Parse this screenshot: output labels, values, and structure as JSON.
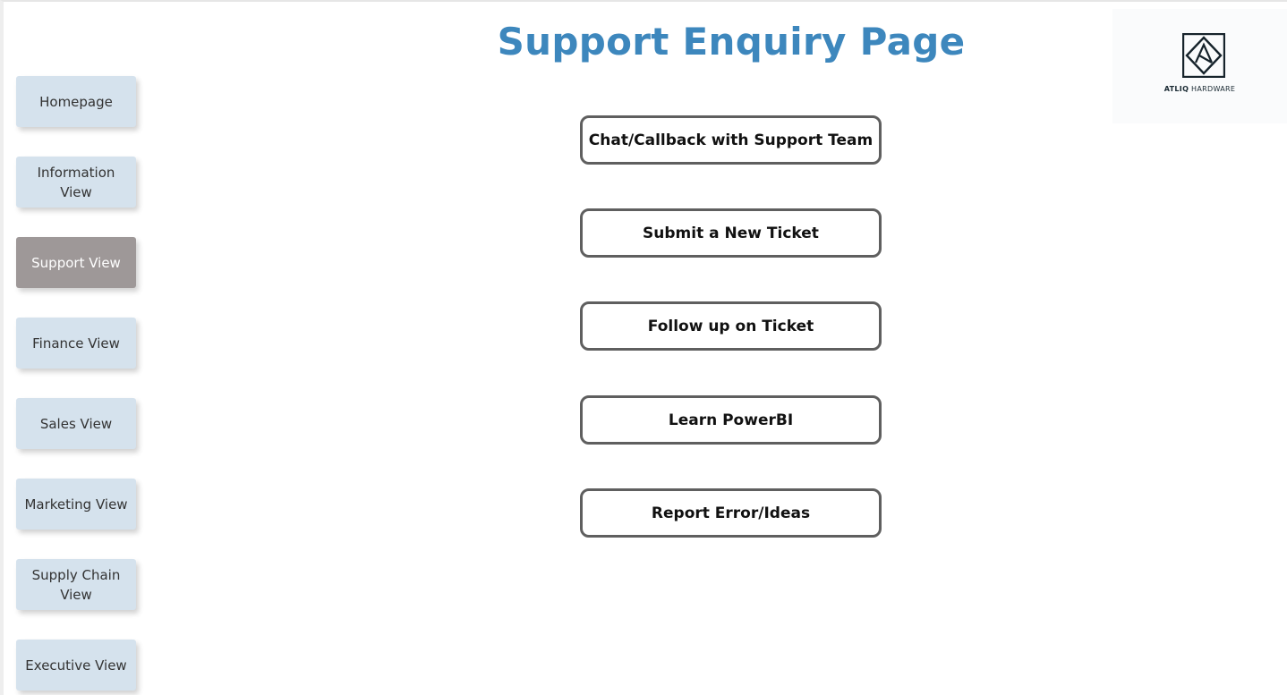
{
  "page": {
    "title": "Support Enquiry Page"
  },
  "logo": {
    "brand_bold": "ATLIQ",
    "brand_rest": "HARDWARE"
  },
  "sidebar": {
    "items": [
      {
        "label": "Homepage",
        "active": false
      },
      {
        "label": "Information View",
        "active": false
      },
      {
        "label": "Support View",
        "active": true
      },
      {
        "label": "Finance View",
        "active": false
      },
      {
        "label": "Sales View",
        "active": false
      },
      {
        "label": "Marketing View",
        "active": false
      },
      {
        "label": "Supply Chain View",
        "active": false
      },
      {
        "label": "Executive View",
        "active": false
      }
    ]
  },
  "actions": {
    "items": [
      {
        "label": "Chat/Callback with Support Team"
      },
      {
        "label": "Submit a New Ticket"
      },
      {
        "label": "Follow up on Ticket"
      },
      {
        "label": "Learn PowerBI"
      },
      {
        "label": "Report Error/Ideas"
      }
    ]
  },
  "colors": {
    "title": "#3d87bd",
    "nav_bg": "#d5e2ed",
    "nav_active_bg": "#9e9898",
    "button_border": "#5f5f5f"
  }
}
